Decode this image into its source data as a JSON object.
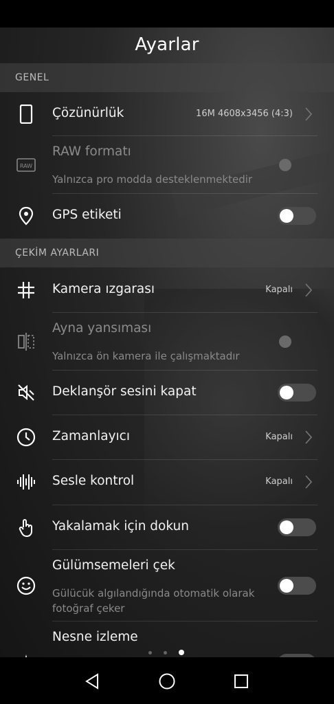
{
  "header": {
    "title": "Ayarlar"
  },
  "sections": {
    "general": "GENEL",
    "capture": "ÇEKİM AYARLARI"
  },
  "rows": {
    "resolution": {
      "label": "Çözünürlük",
      "value": "16M 4608x3456 (4:3)"
    },
    "raw": {
      "label": "RAW formatı",
      "sub": "Yalnızca pro modda desteklenmektedir",
      "enabled": false
    },
    "gps": {
      "label": "GPS etiketi",
      "on": false
    },
    "grid": {
      "label": "Kamera ızgarası",
      "value": "Kapalı"
    },
    "mirror": {
      "label": "Ayna yansıması",
      "sub": "Yalnızca ön kamera ile çalışmaktadır",
      "enabled": false
    },
    "shutter": {
      "label": "Deklanşör sesini kapat",
      "on": false
    },
    "timer": {
      "label": "Zamanlayıcı",
      "value": "Kapalı"
    },
    "voice": {
      "label": "Sesle kontrol",
      "value": "Kapalı"
    },
    "touch": {
      "label": "Yakalamak için dokun",
      "on": false
    },
    "smile": {
      "label": "Gülümsemeleri çek",
      "sub": "Gülücük algılandığında otomatik olarak fotoğraf çeker",
      "on": false
    },
    "tracking": {
      "label": "Nesne izleme"
    }
  },
  "pager": {
    "count": 3,
    "active": 3
  },
  "icons": [
    "phone-outline-icon",
    "raw-icon",
    "location-pin-icon",
    "grid-icon",
    "mirror-icon",
    "mute-shutter-icon",
    "clock-icon",
    "voice-bars-icon",
    "touch-hand-icon",
    "smile-icon",
    "chevron-right-icon",
    "back-triangle-icon",
    "home-circle-icon",
    "recents-square-icon"
  ],
  "colors": {
    "background": "#000000",
    "text": "#f2f2f2",
    "muted": "#8a8a8a",
    "toggle_off": "#4c4c4c"
  }
}
